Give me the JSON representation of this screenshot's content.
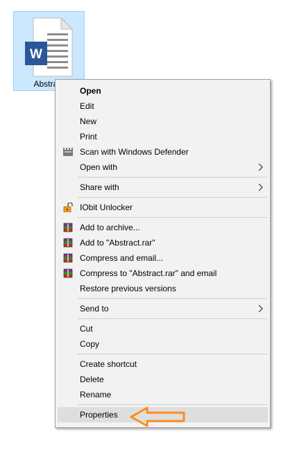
{
  "desktop": {
    "file": {
      "label": "Abstract",
      "icon": "word-document-icon",
      "badge_letter": "W",
      "colors": {
        "badge": "#2b579a",
        "selection_bg": "#cce8ff",
        "selection_border": "#99d1ff"
      }
    }
  },
  "context_menu": {
    "groups": [
      [
        {
          "label": "Open",
          "bold": true
        },
        {
          "label": "Edit"
        },
        {
          "label": "New"
        },
        {
          "label": "Print"
        },
        {
          "label": "Scan with Windows Defender",
          "icon": "windows-defender-icon"
        },
        {
          "label": "Open with",
          "submenu": true
        }
      ],
      [
        {
          "label": "Share with",
          "submenu": true
        }
      ],
      [
        {
          "label": "IObit Unlocker",
          "icon": "iobit-unlocker-icon"
        }
      ],
      [
        {
          "label": "Add to archive...",
          "icon": "winrar-icon"
        },
        {
          "label": "Add to \"Abstract.rar\"",
          "icon": "winrar-icon"
        },
        {
          "label": "Compress and email...",
          "icon": "winrar-icon"
        },
        {
          "label": "Compress to \"Abstract.rar\" and email",
          "icon": "winrar-icon"
        },
        {
          "label": "Restore previous versions"
        }
      ],
      [
        {
          "label": "Send to",
          "submenu": true
        }
      ],
      [
        {
          "label": "Cut"
        },
        {
          "label": "Copy"
        }
      ],
      [
        {
          "label": "Create shortcut"
        },
        {
          "label": "Delete"
        },
        {
          "label": "Rename"
        }
      ],
      [
        {
          "label": "Properties",
          "highlighted": true
        }
      ]
    ],
    "colors": {
      "background": "#f2f2f2",
      "border": "#a0a0a0",
      "highlight": "#dedede",
      "separator": "#cfcfcf"
    }
  },
  "annotation": {
    "icon": "arrow-left-icon",
    "color": "#ff8a1c",
    "points_to": "Properties"
  }
}
